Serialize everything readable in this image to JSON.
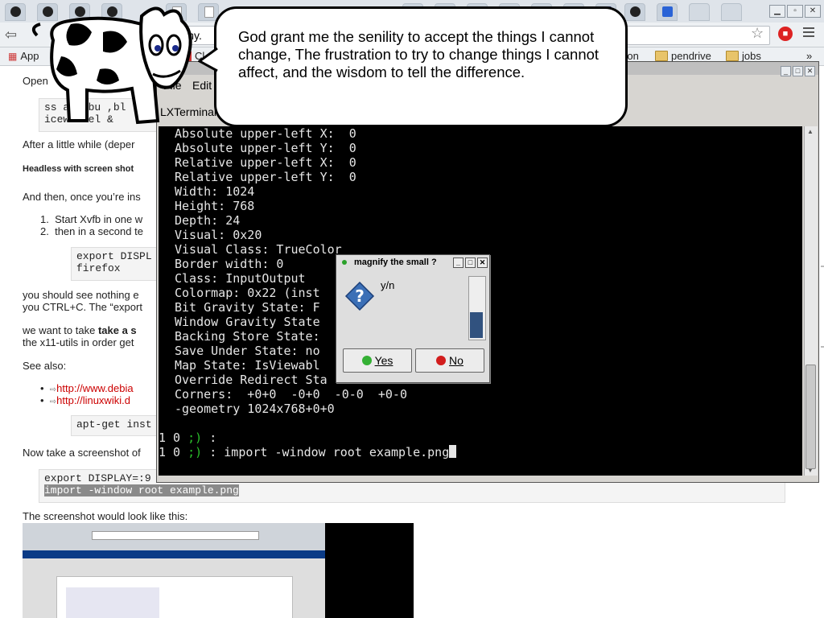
{
  "browser": {
    "url_text": "onomy.",
    "bookmarks": [
      "App",
      "Cl",
      "ison",
      "pendrive",
      "jobs"
    ],
    "more_bookmarks": "»"
  },
  "page": {
    "open_text": "Open",
    "code1_line1": "ss arc bu ,bl",
    "code1_line2": "iceweasel &",
    "after_text": "After a little while (deper",
    "heading": "Headless with screen shot",
    "then_text": "And then, once you’re ins",
    "list1": "Start Xvfb in one w",
    "list2": "then in a second te",
    "code2_line1": "export DISPL",
    "code2_line2": "firefox",
    "see_nothing": "you should see nothing e",
    "ctrl_c": "you CTRL+C. The “export",
    "want_take": "we want to take ",
    "want_bold": "take a s",
    "x11": "the x11-utils in order get",
    "see_also": "See also:",
    "link1": "http://www.debia",
    "link2": "http://linuxwiki.d",
    "code3": "apt-get inst",
    "now_take": "Now take a screenshot of",
    "code4_line1": "export DISPLAY=:9",
    "code4_line2": "import -window root example.png",
    "screenshot_caption": "The screenshot would look like this:"
  },
  "cow_bubble": {
    "quote": "God grant me the senility to accept the things I cannot change, The frustration to try to change things I cannot affect, and the wisdom to tell the difference."
  },
  "terminal": {
    "menu_file": "File",
    "menu_edit": "Edit",
    "tab_title": "LXTerminal",
    "lines": [
      "Absolute upper-left X:  0",
      "Absolute upper-left Y:  0",
      "Relative upper-left X:  0",
      "Relative upper-left Y:  0",
      "Width: 1024",
      "Height: 768",
      "Depth: 24",
      "Visual: 0x20",
      "Visual Class: TrueColor",
      "Border width: 0",
      "Class: InputOutput",
      "Colormap: 0x22 (inst",
      "Bit Gravity State: F",
      "Window Gravity State",
      "Backing Store State:",
      "Save Under State: no",
      "Map State: IsViewabl",
      "Override Redirect Sta",
      "Corners:  +0+0  -0+0  -0-0  +0-0",
      "-geometry 1024x768+0+0"
    ],
    "prompt1_prefix": "1 0 ",
    "prompt1_smiley": ";)",
    "prompt1_suffix": " :",
    "prompt2_prefix": "1 0 ",
    "prompt2_smiley": ";)",
    "prompt2_suffix": " : import -window root example.png"
  },
  "dialog": {
    "title": "magnify the small ?",
    "prompt": "y/n",
    "yes": "Yes",
    "no": "No",
    "progress": 0.42
  }
}
